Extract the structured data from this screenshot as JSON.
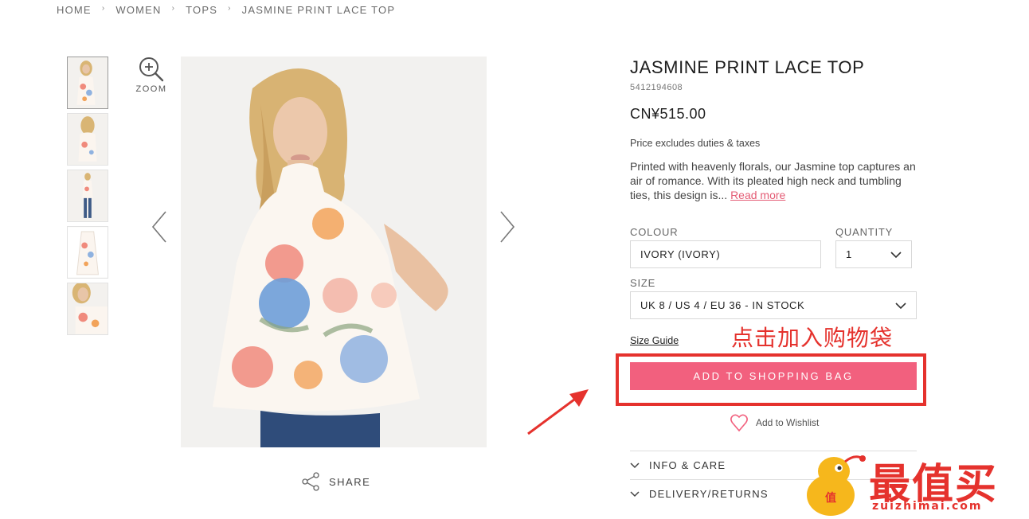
{
  "breadcrumb": {
    "items": [
      "HOME",
      "WOMEN",
      "TOPS",
      "JASMINE PRINT LACE TOP"
    ],
    "separator": "›"
  },
  "gallery": {
    "zoom_label": "ZOOM",
    "share_label": "SHARE",
    "thumbnail_count": 5
  },
  "product": {
    "title": "JASMINE PRINT LACE TOP",
    "sku": "5412194608",
    "price": "CN¥515.00",
    "price_note": "Price excludes duties & taxes",
    "description": "Printed with heavenly florals, our Jasmine top captures an air of romance. With its pleated high neck and tumbling ties, this design is...",
    "read_more": "Read more"
  },
  "options": {
    "colour_label": "COLOUR",
    "colour_value": "IVORY (IVORY)",
    "quantity_label": "QUANTITY",
    "quantity_value": "1",
    "size_label": "SIZE",
    "size_value": "UK 8 / US 4 / EU 36 - IN STOCK",
    "size_guide": "Size Guide"
  },
  "actions": {
    "add_to_bag": "ADD TO SHOPPING BAG",
    "wishlist": "Add to Wishlist"
  },
  "accordions": [
    "INFO & CARE",
    "DELIVERY/RETURNS"
  ],
  "annotation": {
    "text": "点击加入购物袋"
  },
  "watermark": {
    "title": "最值买",
    "url": "zuizhimai.com"
  },
  "colors": {
    "accent_pink": "#f2607e",
    "annotation_red": "#e5322d",
    "link_pink": "#e45b74"
  }
}
